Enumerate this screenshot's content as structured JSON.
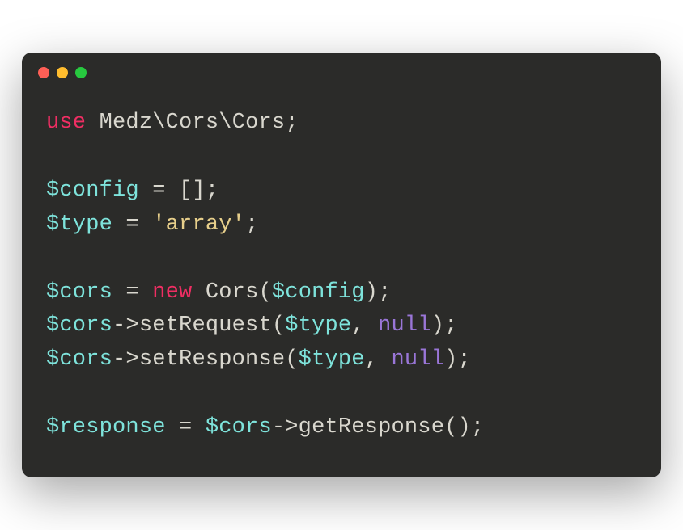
{
  "code": {
    "l1": {
      "kw": "use",
      "ns1": "Medz",
      "bs1": "\\",
      "ns2": "Cors",
      "bs2": "\\",
      "ns3": "Cors",
      "semi": ";"
    },
    "l2": "",
    "l3": {
      "var": "$config",
      "eq": " = ",
      "open": "[]",
      "semi": ";"
    },
    "l4": {
      "var": "$type",
      "eq": " = ",
      "str": "'array'",
      "semi": ";"
    },
    "l5": "",
    "l6": {
      "var": "$cors",
      "eq": " = ",
      "kw": "new",
      "sp": " ",
      "cls": "Cors",
      "op1": "(",
      "arg": "$config",
      "op2": ")",
      "semi": ";"
    },
    "l7": {
      "var": "$cors",
      "arrow": "->",
      "fn": "setRequest",
      "op1": "(",
      "arg1": "$type",
      "comma": ", ",
      "null": "null",
      "op2": ")",
      "semi": ";"
    },
    "l8": {
      "var": "$cors",
      "arrow": "->",
      "fn": "setResponse",
      "op1": "(",
      "arg1": "$type",
      "comma": ", ",
      "null": "null",
      "op2": ")",
      "semi": ";"
    },
    "l9": "",
    "l10": {
      "var": "$response",
      "eq": " = ",
      "var2": "$cors",
      "arrow": "->",
      "fn": "getResponse",
      "op1": "()",
      "semi": ";"
    }
  }
}
